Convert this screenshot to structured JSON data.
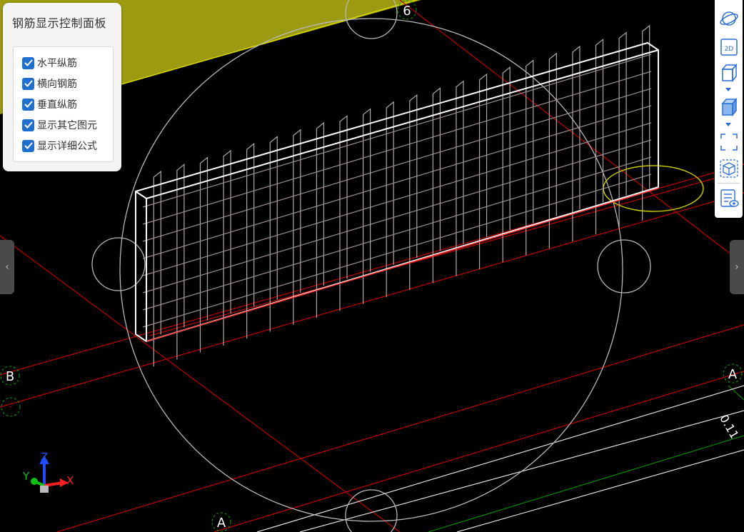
{
  "panel": {
    "title": "钢筋显示控制面板",
    "options": [
      {
        "label": "水平纵筋",
        "checked": true
      },
      {
        "label": "横向钢筋",
        "checked": true
      },
      {
        "label": "垂直纵筋",
        "checked": true
      },
      {
        "label": "显示其它图元",
        "checked": true
      },
      {
        "label": "显示详细公式",
        "checked": true
      }
    ]
  },
  "toolbar": {
    "buttons": [
      {
        "icon": "orbit-icon"
      },
      {
        "icon": "2d-view-icon",
        "label": "2D"
      },
      {
        "icon": "3d-box-icon"
      },
      {
        "icon": "solid-box-icon"
      },
      {
        "icon": "fit-view-icon"
      },
      {
        "icon": "section-box-icon"
      },
      {
        "icon": "properties-icon"
      }
    ]
  },
  "axes": {
    "gridlines": [
      "B",
      "A",
      "A"
    ],
    "top_axis": "6",
    "extra_label": "0.11"
  },
  "triad": {
    "x": "X",
    "y": "Y",
    "z": "Z"
  },
  "side_tabs": {
    "left": "‹",
    "right": "›"
  },
  "colors": {
    "accent": "#1f6fd1",
    "grid_red": "#d40000",
    "slab_yellow": "#9a9a10"
  }
}
